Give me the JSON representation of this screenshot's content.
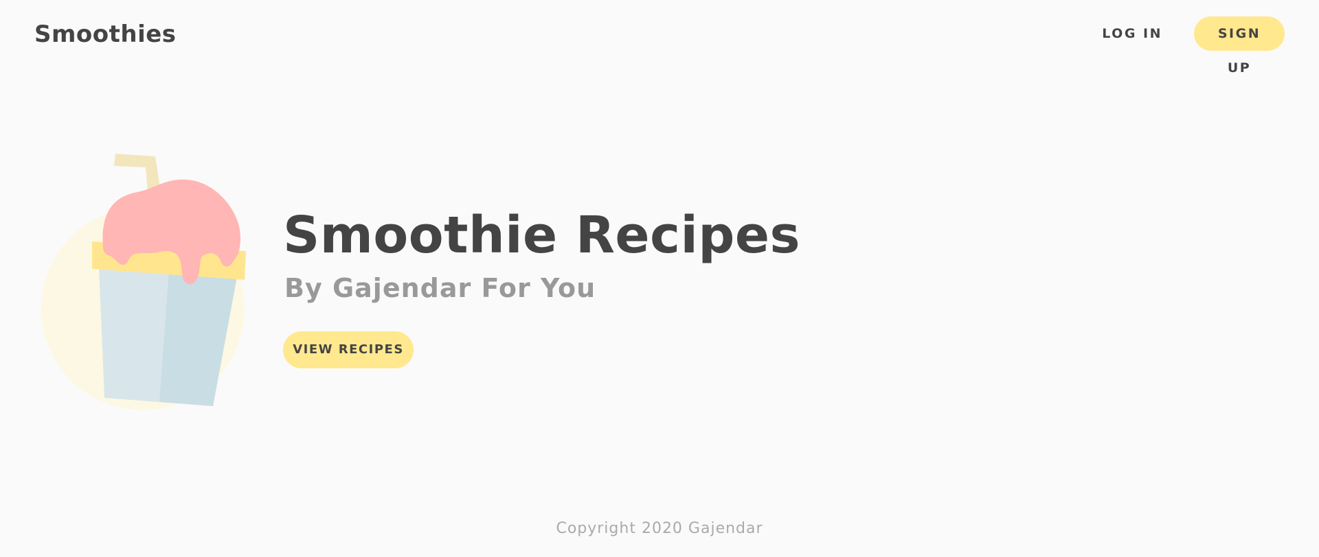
{
  "header": {
    "brand": "Smoothies",
    "nav": {
      "login_label": "LOG IN",
      "signup_label": "SIGN UP"
    }
  },
  "hero": {
    "title": "Smoothie Recipes",
    "subtitle": "By Gajendar For You",
    "cta_label": "VIEW RECIPES",
    "illustration": "smoothie-cup-icon"
  },
  "footer": {
    "copyright": "Copyright 2020 Gajendar"
  },
  "colors": {
    "background": "#fafafa",
    "accent": "#ffe88e",
    "text_dark": "#444444",
    "text_muted": "#999999",
    "footer_text": "#aaaaaa",
    "cup_light": "#d8e6eb",
    "cup_shade": "#c9dde4",
    "smoothie_pink": "#ffb6b4",
    "lid_yellow": "#ffe68e",
    "straw": "#f3e6bd",
    "glow": "#fdf8e3"
  }
}
